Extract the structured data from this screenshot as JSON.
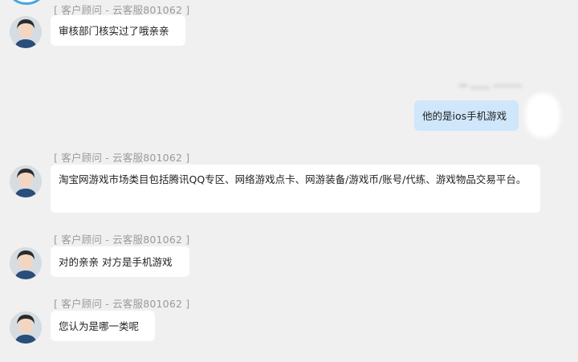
{
  "agent": {
    "label": "[ 客户顾问  -  云客服801062 ]"
  },
  "messages": [
    {
      "sender": "agent",
      "text": "审核部门核实过了哦亲亲"
    },
    {
      "sender": "user",
      "text": "他的是ios手机游戏"
    },
    {
      "sender": "agent",
      "text": "淘宝网游戏市场类目包括腾讯QQ专区、网络游戏点卡、网游装备/游戏币/账号/代练、游戏物品交易平台。"
    },
    {
      "sender": "agent",
      "text": "对的亲亲 对方是手机游戏"
    },
    {
      "sender": "agent",
      "text": "您认为是哪一类呢"
    }
  ],
  "colors": {
    "agent_bubble": "#ffffff",
    "user_bubble": "#cfe6fb",
    "background": "#f0f0f0",
    "top_avatar_ring": "#47a6da"
  }
}
